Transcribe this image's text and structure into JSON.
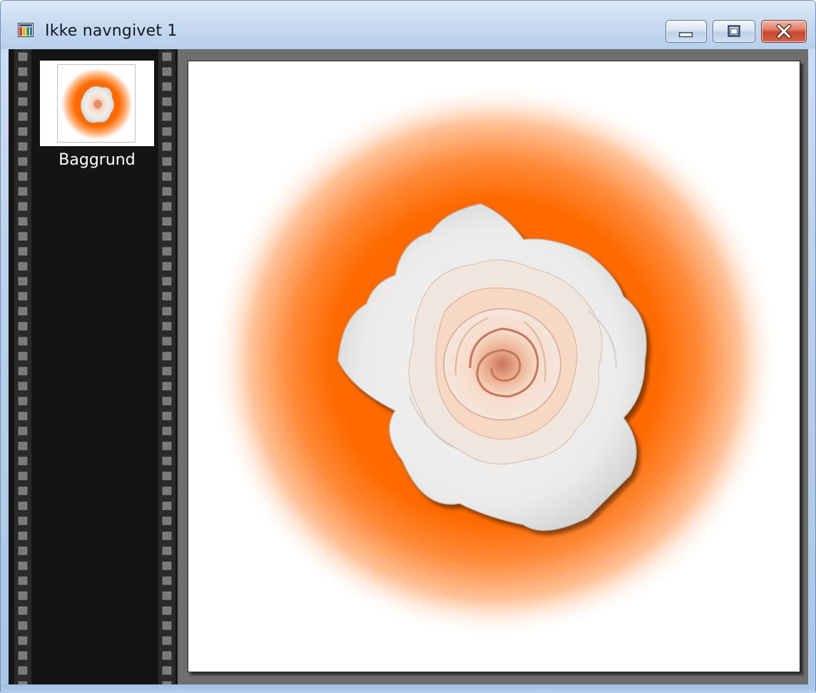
{
  "window": {
    "title": "Ikke navngivet 1",
    "icon": "image-document-icon"
  },
  "title_buttons": {
    "minimize_icon": "minimize-icon",
    "maximize_icon": "maximize-icon",
    "close_icon": "close-icon"
  },
  "filmstrip": {
    "layers": [
      {
        "label": "Baggrund",
        "thumbnail": "rose-on-orange-glow"
      }
    ]
  },
  "canvas": {
    "image": "white-rose-on-orange-radial-glow",
    "colors": {
      "glow": "#ff6a00",
      "background": "#ffffff"
    }
  }
}
